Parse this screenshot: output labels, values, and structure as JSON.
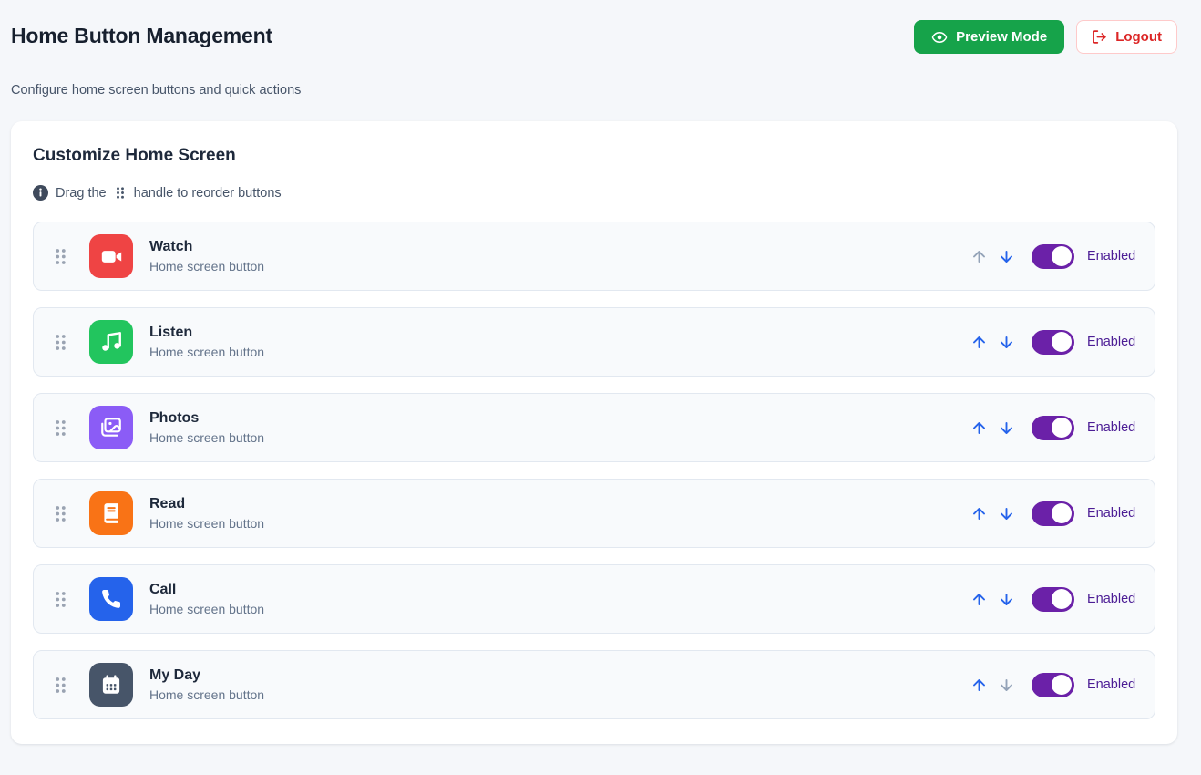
{
  "header": {
    "title": "Home Button Management",
    "subtitle": "Configure home screen buttons and quick actions",
    "preview_button_label": "Preview Mode",
    "logout_button_label": "Logout"
  },
  "card": {
    "title": "Customize Home Screen",
    "hint_prefix": "Drag the",
    "hint_suffix": "handle to reorder buttons"
  },
  "rows": [
    {
      "label": "Watch",
      "description": "Home screen button",
      "icon": "video-icon",
      "icon_color": "#ef4444",
      "enabled": true,
      "status_label": "Enabled",
      "up_enabled": false,
      "down_enabled": true
    },
    {
      "label": "Listen",
      "description": "Home screen button",
      "icon": "music-icon",
      "icon_color": "#22c55e",
      "enabled": true,
      "status_label": "Enabled",
      "up_enabled": true,
      "down_enabled": true
    },
    {
      "label": "Photos",
      "description": "Home screen button",
      "icon": "images-icon",
      "icon_color": "#8b5cf6",
      "enabled": true,
      "status_label": "Enabled",
      "up_enabled": true,
      "down_enabled": true
    },
    {
      "label": "Read",
      "description": "Home screen button",
      "icon": "book-icon",
      "icon_color": "#f97316",
      "enabled": true,
      "status_label": "Enabled",
      "up_enabled": true,
      "down_enabled": true
    },
    {
      "label": "Call",
      "description": "Home screen button",
      "icon": "phone-icon",
      "icon_color": "#2563eb",
      "enabled": true,
      "status_label": "Enabled",
      "up_enabled": true,
      "down_enabled": true
    },
    {
      "label": "My Day",
      "description": "Home screen button",
      "icon": "calendar-icon",
      "icon_color": "#475569",
      "enabled": true,
      "status_label": "Enabled",
      "up_enabled": true,
      "down_enabled": false
    }
  ],
  "colors": {
    "preview_green": "#16a34a",
    "logout_red": "#dc2626",
    "toggle_purple": "#6b21a8",
    "enabled_text_purple": "#4c1d95",
    "arrow_blue": "#2563eb",
    "arrow_disabled_gray": "#94a3b8",
    "page_background": "#f5f7fa",
    "row_background": "#f8fafc"
  }
}
